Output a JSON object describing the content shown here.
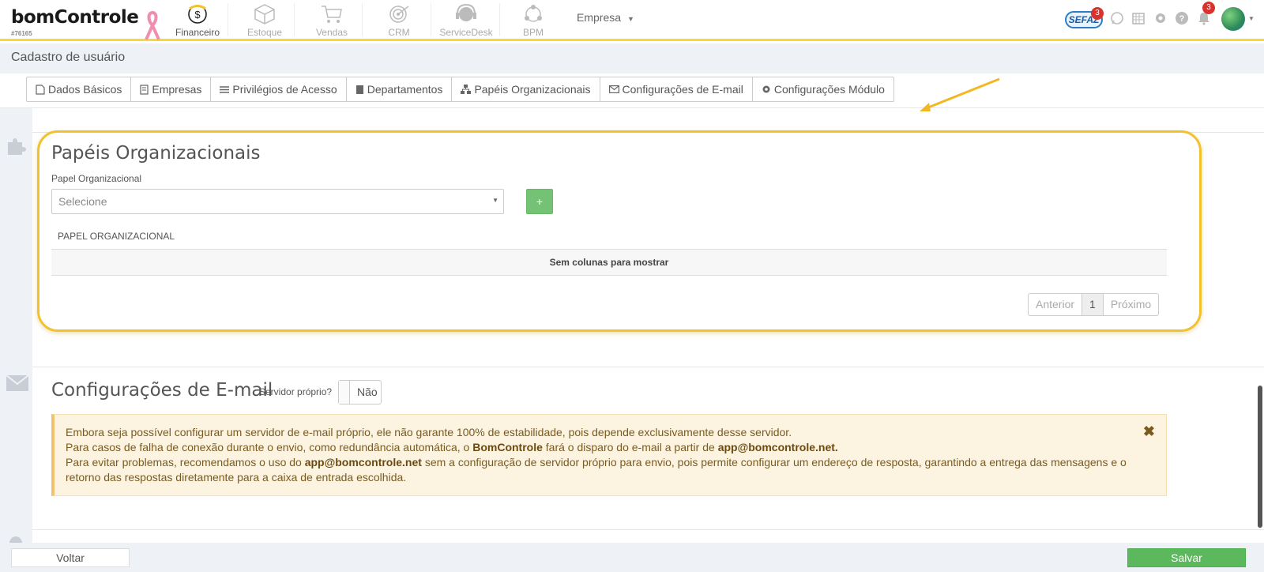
{
  "header": {
    "logo_text": "bomControle",
    "logo_id": "#76165",
    "modules": [
      {
        "label": "Financeiro",
        "icon": "coin-dollar-icon",
        "active": true
      },
      {
        "label": "Estoque",
        "icon": "box-icon",
        "active": false
      },
      {
        "label": "Vendas",
        "icon": "cart-icon",
        "active": false
      },
      {
        "label": "CRM",
        "icon": "target-icon",
        "active": false
      },
      {
        "label": "ServiceDesk",
        "icon": "headset-icon",
        "active": false
      },
      {
        "label": "BPM",
        "icon": "network-icon",
        "active": false
      }
    ],
    "company_label": "Empresa",
    "sefaz_label": "SEFAZ",
    "sefaz_badge": "3",
    "notifications_badge": "3"
  },
  "page": {
    "title": "Cadastro de usuário"
  },
  "tabs": [
    {
      "label": "Dados Básicos",
      "icon": "file-icon"
    },
    {
      "label": "Empresas",
      "icon": "building-icon"
    },
    {
      "label": "Privilégios de Acesso",
      "icon": "list-icon"
    },
    {
      "label": "Departamentos",
      "icon": "building-icon"
    },
    {
      "label": "Papéis Organizacionais",
      "icon": "sitemap-icon"
    },
    {
      "label": "Configurações de E-mail",
      "icon": "envelope-icon"
    },
    {
      "label": "Configurações Módulo",
      "icon": "gear-icon"
    }
  ],
  "papeis": {
    "title": "Papéis Organizacionais",
    "field_label": "Papel Organizacional",
    "select_value": "Selecione",
    "add_label": "+",
    "column_header": "PAPEL ORGANIZACIONAL",
    "empty_text": "Sem colunas para mostrar",
    "pager": {
      "prev": "Anterior",
      "current": "1",
      "next": "Próximo"
    }
  },
  "email": {
    "title": "Configurações de E-mail",
    "server_label": "Servidor próprio?",
    "toggle_value": "Não",
    "alert": {
      "line1": "Embora seja possível configurar um servidor de e-mail próprio, ele não garante 100% de estabilidade, pois depende exclusivamente desse servidor.",
      "line2_a": "Para casos de falha de conexão durante o envio, como redundância automática, o ",
      "line2_b": "BomControle",
      "line2_c": " fará o disparo do e-mail a partir de ",
      "line2_d": "app@bomcontrole.net.",
      "line3_a": "Para evitar problemas, recomendamos o uso do ",
      "line3_b": "app@bomcontrole.net",
      "line3_c": " sem a configuração de servidor próprio para envio, pois permite configurar um endereço de resposta, garantindo a entrega das mensagens e o retorno das respostas diretamente para a caixa de entrada escolhida.",
      "close": "✖"
    }
  },
  "footer": {
    "back_label": "Voltar",
    "save_label": "Salvar"
  },
  "colors": {
    "accent_yellow": "#f5d938",
    "highlight_border": "#f2c12e",
    "success_green": "#5cb85c",
    "badge_red": "#d9322c"
  }
}
